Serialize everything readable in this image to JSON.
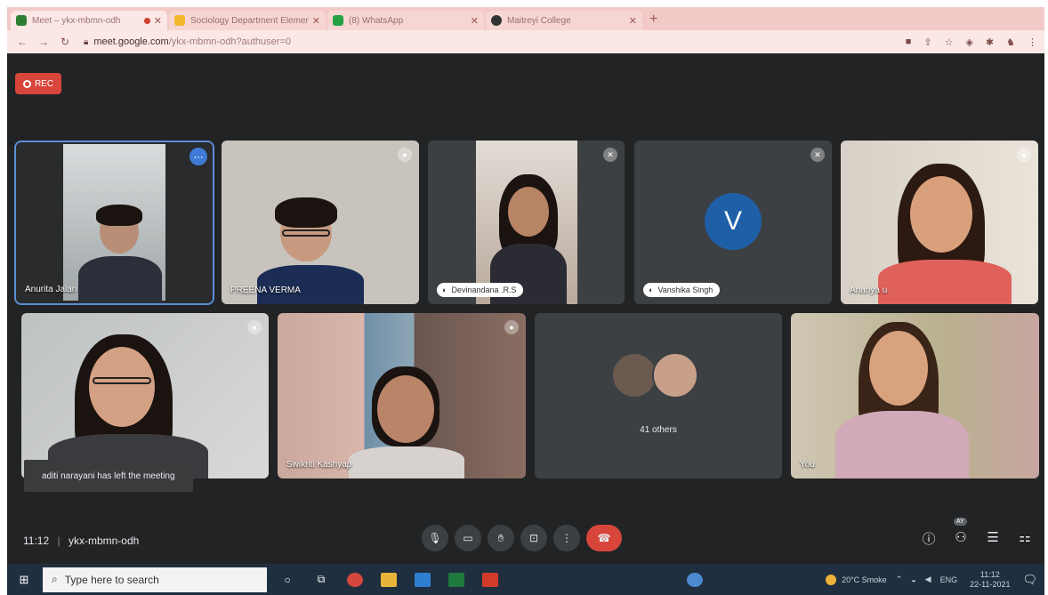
{
  "browser": {
    "tabs": [
      {
        "title": "Meet – ykx-mbmn-odh",
        "active": true,
        "recording": true,
        "favicon_color": "#2e7d32"
      },
      {
        "title": "Sociology Department Elements",
        "active": false,
        "favicon_color": "#f1b82d"
      },
      {
        "title": "(8) WhatsApp",
        "active": false,
        "favicon_color": "#25a244"
      },
      {
        "title": "Maitreyi College",
        "active": false,
        "favicon_color": "#333333"
      }
    ],
    "new_tab": "+",
    "url_host": "meet.google.com",
    "url_path": "/ykx-mbmn-odh?authuser=0"
  },
  "meet": {
    "rec_label": "REC",
    "tiles": [
      {
        "name": "Anurita Jalan",
        "kind": "video"
      },
      {
        "name": "PREENA VERMA",
        "kind": "video"
      },
      {
        "name": "Devinandana .R.S",
        "kind": "video-muted"
      },
      {
        "name": "Vanshika Singh",
        "kind": "avatar",
        "initial": "V"
      },
      {
        "name": "Ananya u",
        "kind": "video"
      },
      {
        "name": "",
        "kind": "video"
      },
      {
        "name": "Swikriti Kashyap",
        "kind": "video"
      },
      {
        "label": "41 others",
        "kind": "others"
      },
      {
        "name": "You",
        "kind": "video"
      }
    ],
    "toast": "aditi narayani has left the meeting",
    "time": "11:12",
    "meeting_code": "ykx-mbmn-odh",
    "participants_badge": "AY"
  },
  "taskbar": {
    "search_placeholder": "Type here to search",
    "weather": "20°C Smoke",
    "lang": "ENG",
    "clock_time": "11:12",
    "clock_date": "22-11-2021"
  }
}
